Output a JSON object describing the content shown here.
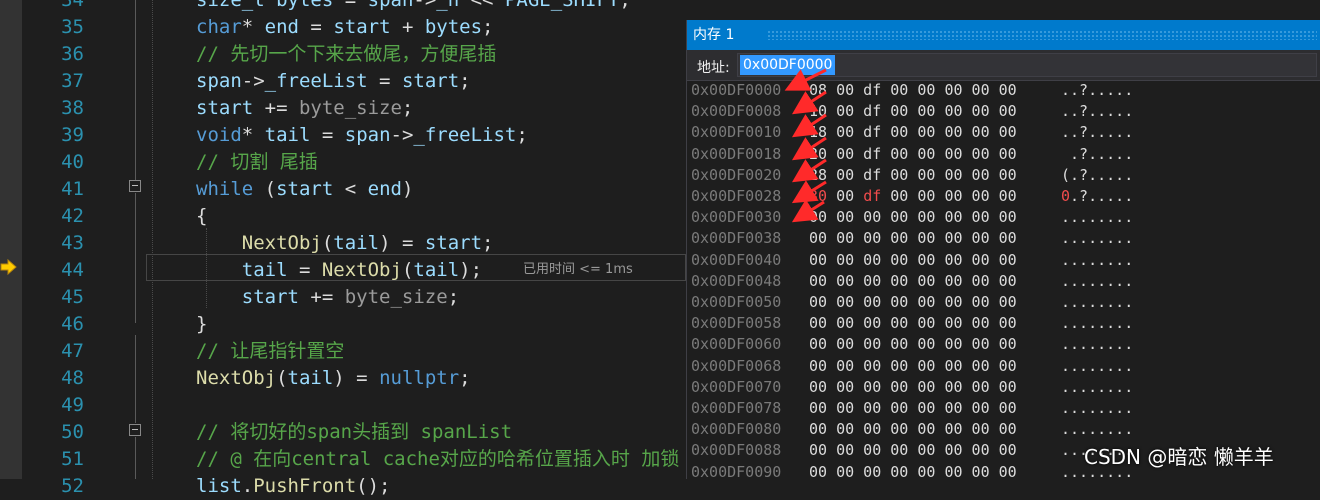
{
  "editor": {
    "lines": [
      {
        "no": "34",
        "html": "<span class=\"var\">size_t</span> <span class=\"var\">bytes</span> = <span class=\"var\">span</span>-><span class=\"var\">_n</span> << <span class=\"var\">PAGE_SHIFT</span>;"
      },
      {
        "no": "35",
        "html": "<span class=\"kw\">char</span>* <span class=\"var\">end</span> = <span class=\"var\">start</span> + <span class=\"var\">bytes</span>;"
      },
      {
        "no": "36",
        "html": "<span class=\"cm\">// 先切一个下来去做尾，方便尾插</span>"
      },
      {
        "no": "37",
        "html": "<span class=\"var\">span</span>-><span class=\"var\">_freeList</span> = <span class=\"var\">start</span>;"
      },
      {
        "no": "38",
        "html": "<span class=\"var\">start</span> += <span class=\"gray\">byte_size</span>;"
      },
      {
        "no": "39",
        "html": "<span class=\"kw\">void</span>* <span class=\"var\">tail</span> = <span class=\"var\">span</span>-><span class=\"var\">_freeList</span>;"
      },
      {
        "no": "40",
        "html": "<span class=\"cm\">// 切割 尾插</span>"
      },
      {
        "no": "41",
        "html": "<span class=\"kw\">while</span> (<span class=\"var\">start</span> < <span class=\"var\">end</span>)"
      },
      {
        "no": "42",
        "html": "{"
      },
      {
        "no": "43",
        "html": "    <span class=\"fn\">NextObj</span>(<span class=\"var\">tail</span>) = <span class=\"var\">start</span>;"
      },
      {
        "no": "44",
        "html": "    <span class=\"var\">tail</span> = <span class=\"fn\">NextObj</span>(<span class=\"var\">tail</span>);"
      },
      {
        "no": "45",
        "html": "    <span class=\"var\">start</span> += <span class=\"gray\">byte_size</span>;"
      },
      {
        "no": "46",
        "html": "}"
      },
      {
        "no": "47",
        "html": "<span class=\"cm\">// 让尾指针置空</span>"
      },
      {
        "no": "48",
        "html": "<span class=\"fn\">NextObj</span>(<span class=\"var\">tail</span>) = <span class=\"kw\">nullptr</span>;"
      },
      {
        "no": "49",
        "html": ""
      },
      {
        "no": "50",
        "html": "<span class=\"cm\">// 将切好的span头插到 spanList</span>"
      },
      {
        "no": "51",
        "html": "<span class=\"cm\">// @ 在向central cache对应的哈希位置插入时 加锁</span>"
      },
      {
        "no": "52",
        "html": "<span class=\"var\">list</span>.<span class=\"fn\">PushFront</span>();"
      }
    ],
    "elapsed_hint": "已用时间 <= 1ms"
  },
  "memory_window": {
    "title": "内存 1",
    "address_label": "地址:",
    "address_value": "0x00DF0000",
    "rows": [
      {
        "addr": "0x00DF0000",
        "b0": "08",
        "rest": "00 df 00 00 00 00 00",
        "ascii": "..?.....",
        "changed": false
      },
      {
        "addr": "0x00DF0008",
        "b0": "10",
        "rest": "00 df 00 00 00 00 00",
        "ascii": "..?.....",
        "changed": false
      },
      {
        "addr": "0x00DF0010",
        "b0": "18",
        "rest": "00 df 00 00 00 00 00",
        "ascii": "..?.....",
        "changed": false
      },
      {
        "addr": "0x00DF0018",
        "b0": "20",
        "rest": "00 df 00 00 00 00 00",
        "ascii": " .?.....",
        "changed": false
      },
      {
        "addr": "0x00DF0020",
        "b0": "28",
        "rest": "00 df 00 00 00 00 00",
        "ascii": "(.?.....",
        "changed": false
      },
      {
        "addr": "0x00DF0028",
        "b0": "30",
        "rest": "00 df 00 00 00 00 00",
        "ascii": "0.?.....",
        "changed": true
      },
      {
        "addr": "0x00DF0030",
        "b0": "00",
        "rest": "00 00 00 00 00 00 00",
        "ascii": "........",
        "changed": false
      },
      {
        "addr": "0x00DF0038",
        "b0": "00",
        "rest": "00 00 00 00 00 00 00",
        "ascii": "........",
        "changed": false
      },
      {
        "addr": "0x00DF0040",
        "b0": "00",
        "rest": "00 00 00 00 00 00 00",
        "ascii": "........",
        "changed": false
      },
      {
        "addr": "0x00DF0048",
        "b0": "00",
        "rest": "00 00 00 00 00 00 00",
        "ascii": "........",
        "changed": false
      },
      {
        "addr": "0x00DF0050",
        "b0": "00",
        "rest": "00 00 00 00 00 00 00",
        "ascii": "........",
        "changed": false
      },
      {
        "addr": "0x00DF0058",
        "b0": "00",
        "rest": "00 00 00 00 00 00 00",
        "ascii": "........",
        "changed": false
      },
      {
        "addr": "0x00DF0060",
        "b0": "00",
        "rest": "00 00 00 00 00 00 00",
        "ascii": "........",
        "changed": false
      },
      {
        "addr": "0x00DF0068",
        "b0": "00",
        "rest": "00 00 00 00 00 00 00",
        "ascii": "........",
        "changed": false
      },
      {
        "addr": "0x00DF0070",
        "b0": "00",
        "rest": "00 00 00 00 00 00 00",
        "ascii": "........",
        "changed": false
      },
      {
        "addr": "0x00DF0078",
        "b0": "00",
        "rest": "00 00 00 00 00 00 00",
        "ascii": "........",
        "changed": false
      },
      {
        "addr": "0x00DF0080",
        "b0": "00",
        "rest": "00 00 00 00 00 00 00",
        "ascii": "........",
        "changed": false
      },
      {
        "addr": "0x00DF0088",
        "b0": "00",
        "rest": "00 00 00 00 00 00 00",
        "ascii": "........",
        "changed": false
      },
      {
        "addr": "0x00DF0090",
        "b0": "00",
        "rest": "00 00 00 00 00 00 00",
        "ascii": "........",
        "changed": false
      }
    ]
  },
  "watermark": "CSDN @暗恋 懒羊羊",
  "colors": {
    "accent": "#007acc",
    "annotation_arrow": "#ff2a2a",
    "changed_value": "#f14c4c",
    "line_number": "#2b91af"
  }
}
